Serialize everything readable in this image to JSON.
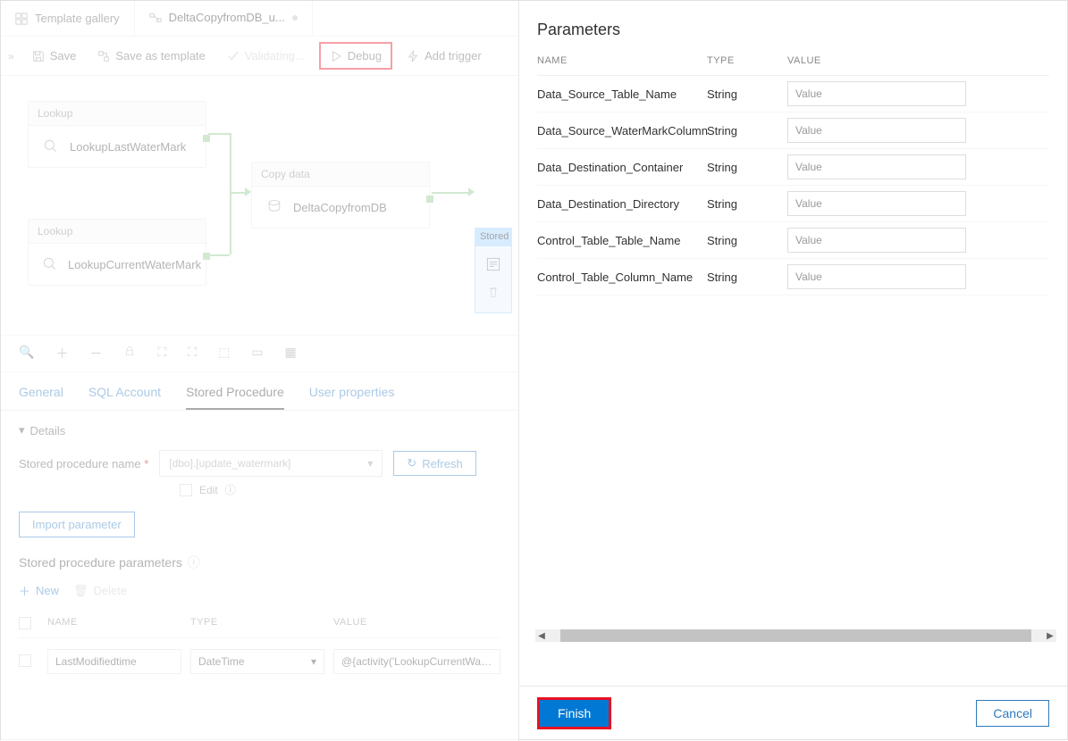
{
  "tabs": [
    {
      "label": "Template gallery"
    },
    {
      "label": "DeltaCopyfromDB_u..."
    }
  ],
  "toolbar": {
    "save": "Save",
    "save_as_template": "Save as template",
    "validating": "Validating...",
    "debug": "Debug",
    "add_trigger": "Add trigger"
  },
  "canvas": {
    "lookup1": {
      "header": "Lookup",
      "label": "LookupLastWaterMark"
    },
    "lookup2": {
      "header": "Lookup",
      "label": "LookupCurrentWaterMark"
    },
    "copy": {
      "header": "Copy data",
      "label": "DeltaCopyfromDB"
    },
    "stored": {
      "header": "Stored"
    }
  },
  "prop_tabs": {
    "general": "General",
    "sql_account": "SQL Account",
    "stored_procedure": "Stored Procedure",
    "user_properties": "User properties"
  },
  "details": {
    "title": "Details",
    "sp_name_label": "Stored procedure name",
    "sp_name_value": "[dbo].[update_watermark]",
    "edit": "Edit",
    "refresh": "Refresh",
    "import_parameter": "Import parameter",
    "sp_params_title": "Stored procedure parameters",
    "new": "New",
    "delete": "Delete",
    "cols": {
      "name": "NAME",
      "type": "TYPE",
      "value": "VALUE"
    },
    "row": {
      "name": "LastModifiedtime",
      "type": "DateTime",
      "value": "@{activity('LookupCurrentWaterMark').output.firstRow.NewWatermarkValue}"
    }
  },
  "right_panel": {
    "title": "Parameters",
    "cols": {
      "name": "NAME",
      "type": "TYPE",
      "value": "VALUE"
    },
    "value_placeholder": "Value",
    "rows": [
      {
        "name": "Data_Source_Table_Name",
        "type": "String"
      },
      {
        "name": "Data_Source_WaterMarkColumn",
        "type": "String"
      },
      {
        "name": "Data_Destination_Container",
        "type": "String"
      },
      {
        "name": "Data_Destination_Directory",
        "type": "String"
      },
      {
        "name": "Control_Table_Table_Name",
        "type": "String"
      },
      {
        "name": "Control_Table_Column_Name",
        "type": "String"
      }
    ],
    "finish": "Finish",
    "cancel": "Cancel"
  }
}
